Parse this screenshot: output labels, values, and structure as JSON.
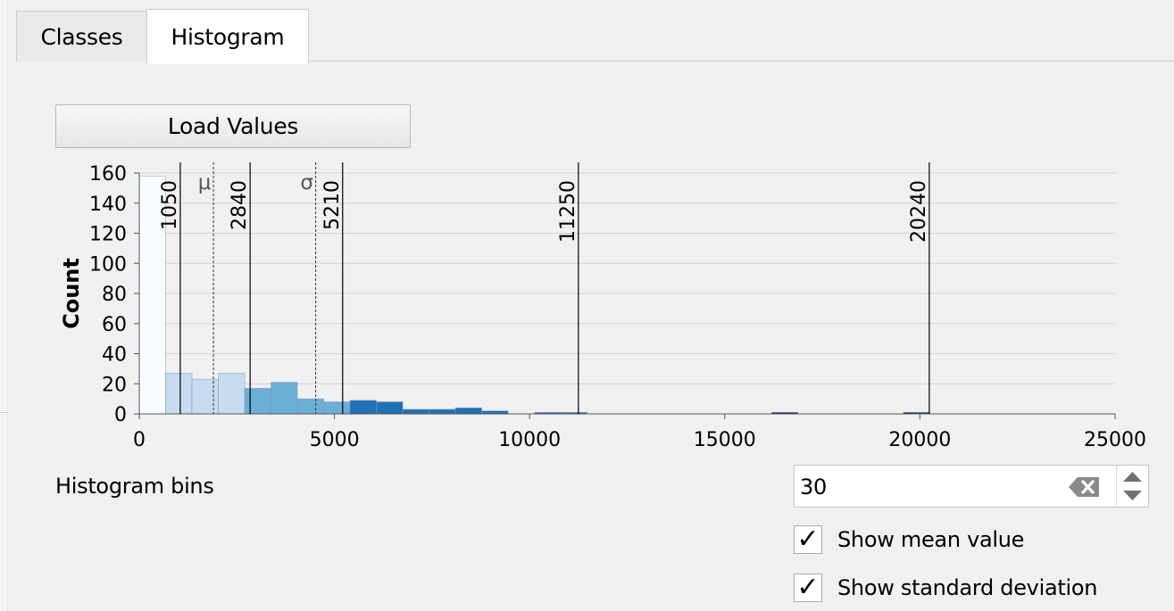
{
  "tabs": [
    {
      "label": "Classes",
      "active": false
    },
    {
      "label": "Histogram",
      "active": true
    }
  ],
  "load_button": {
    "label": "Load Values"
  },
  "histogram_bins": {
    "label": "Histogram bins",
    "value": "30"
  },
  "options": {
    "show_mean": {
      "label": "Show mean value",
      "checked": true,
      "mark": "✓"
    },
    "show_std": {
      "label": "Show standard deviation",
      "checked": true,
      "mark": "✓"
    }
  },
  "chart_data": {
    "type": "bar",
    "ylabel": "Count",
    "xlabel": "",
    "xlim": [
      0,
      25000
    ],
    "ylim": [
      0,
      160
    ],
    "xticks": [
      0,
      5000,
      10000,
      15000,
      20000,
      25000
    ],
    "yticks": [
      0,
      20,
      40,
      60,
      80,
      100,
      120,
      140,
      160
    ],
    "grid": true,
    "bins": [
      {
        "x0": 0,
        "x1": 675,
        "count": 158,
        "color": "#f7fbff"
      },
      {
        "x0": 675,
        "x1": 1350,
        "count": 27,
        "color": "#c6dbef"
      },
      {
        "x0": 1350,
        "x1": 2025,
        "count": 23,
        "color": "#c6dbef"
      },
      {
        "x0": 2025,
        "x1": 2700,
        "count": 27,
        "color": "#c6dbef"
      },
      {
        "x0": 2700,
        "x1": 3375,
        "count": 17,
        "color": "#6baed6"
      },
      {
        "x0": 3375,
        "x1": 4050,
        "count": 21,
        "color": "#6baed6"
      },
      {
        "x0": 4050,
        "x1": 4725,
        "count": 10,
        "color": "#6baed6"
      },
      {
        "x0": 4725,
        "x1": 5400,
        "count": 8,
        "color": "#6baed6"
      },
      {
        "x0": 5400,
        "x1": 6075,
        "count": 9,
        "color": "#2171b5"
      },
      {
        "x0": 6075,
        "x1": 6750,
        "count": 8,
        "color": "#2171b5"
      },
      {
        "x0": 6750,
        "x1": 7425,
        "count": 3,
        "color": "#2171b5"
      },
      {
        "x0": 7425,
        "x1": 8100,
        "count": 3,
        "color": "#2171b5"
      },
      {
        "x0": 8100,
        "x1": 8775,
        "count": 4,
        "color": "#2171b5"
      },
      {
        "x0": 8775,
        "x1": 9450,
        "count": 2,
        "color": "#2171b5"
      },
      {
        "x0": 9450,
        "x1": 10125,
        "count": 0,
        "color": "#2171b5"
      },
      {
        "x0": 10125,
        "x1": 10800,
        "count": 1,
        "color": "#2171b5"
      },
      {
        "x0": 10800,
        "x1": 11475,
        "count": 1,
        "color": "#2171b5"
      },
      {
        "x0": 16200,
        "x1": 16875,
        "count": 1,
        "color": "#08306b"
      },
      {
        "x0": 19575,
        "x1": 20250,
        "count": 1,
        "color": "#08306b"
      }
    ],
    "class_breaks": [
      1050,
      2840,
      5210,
      11250,
      20240
    ],
    "mean": {
      "label": "μ",
      "value": 1900
    },
    "std": {
      "label": "σ",
      "value": 4520
    }
  }
}
